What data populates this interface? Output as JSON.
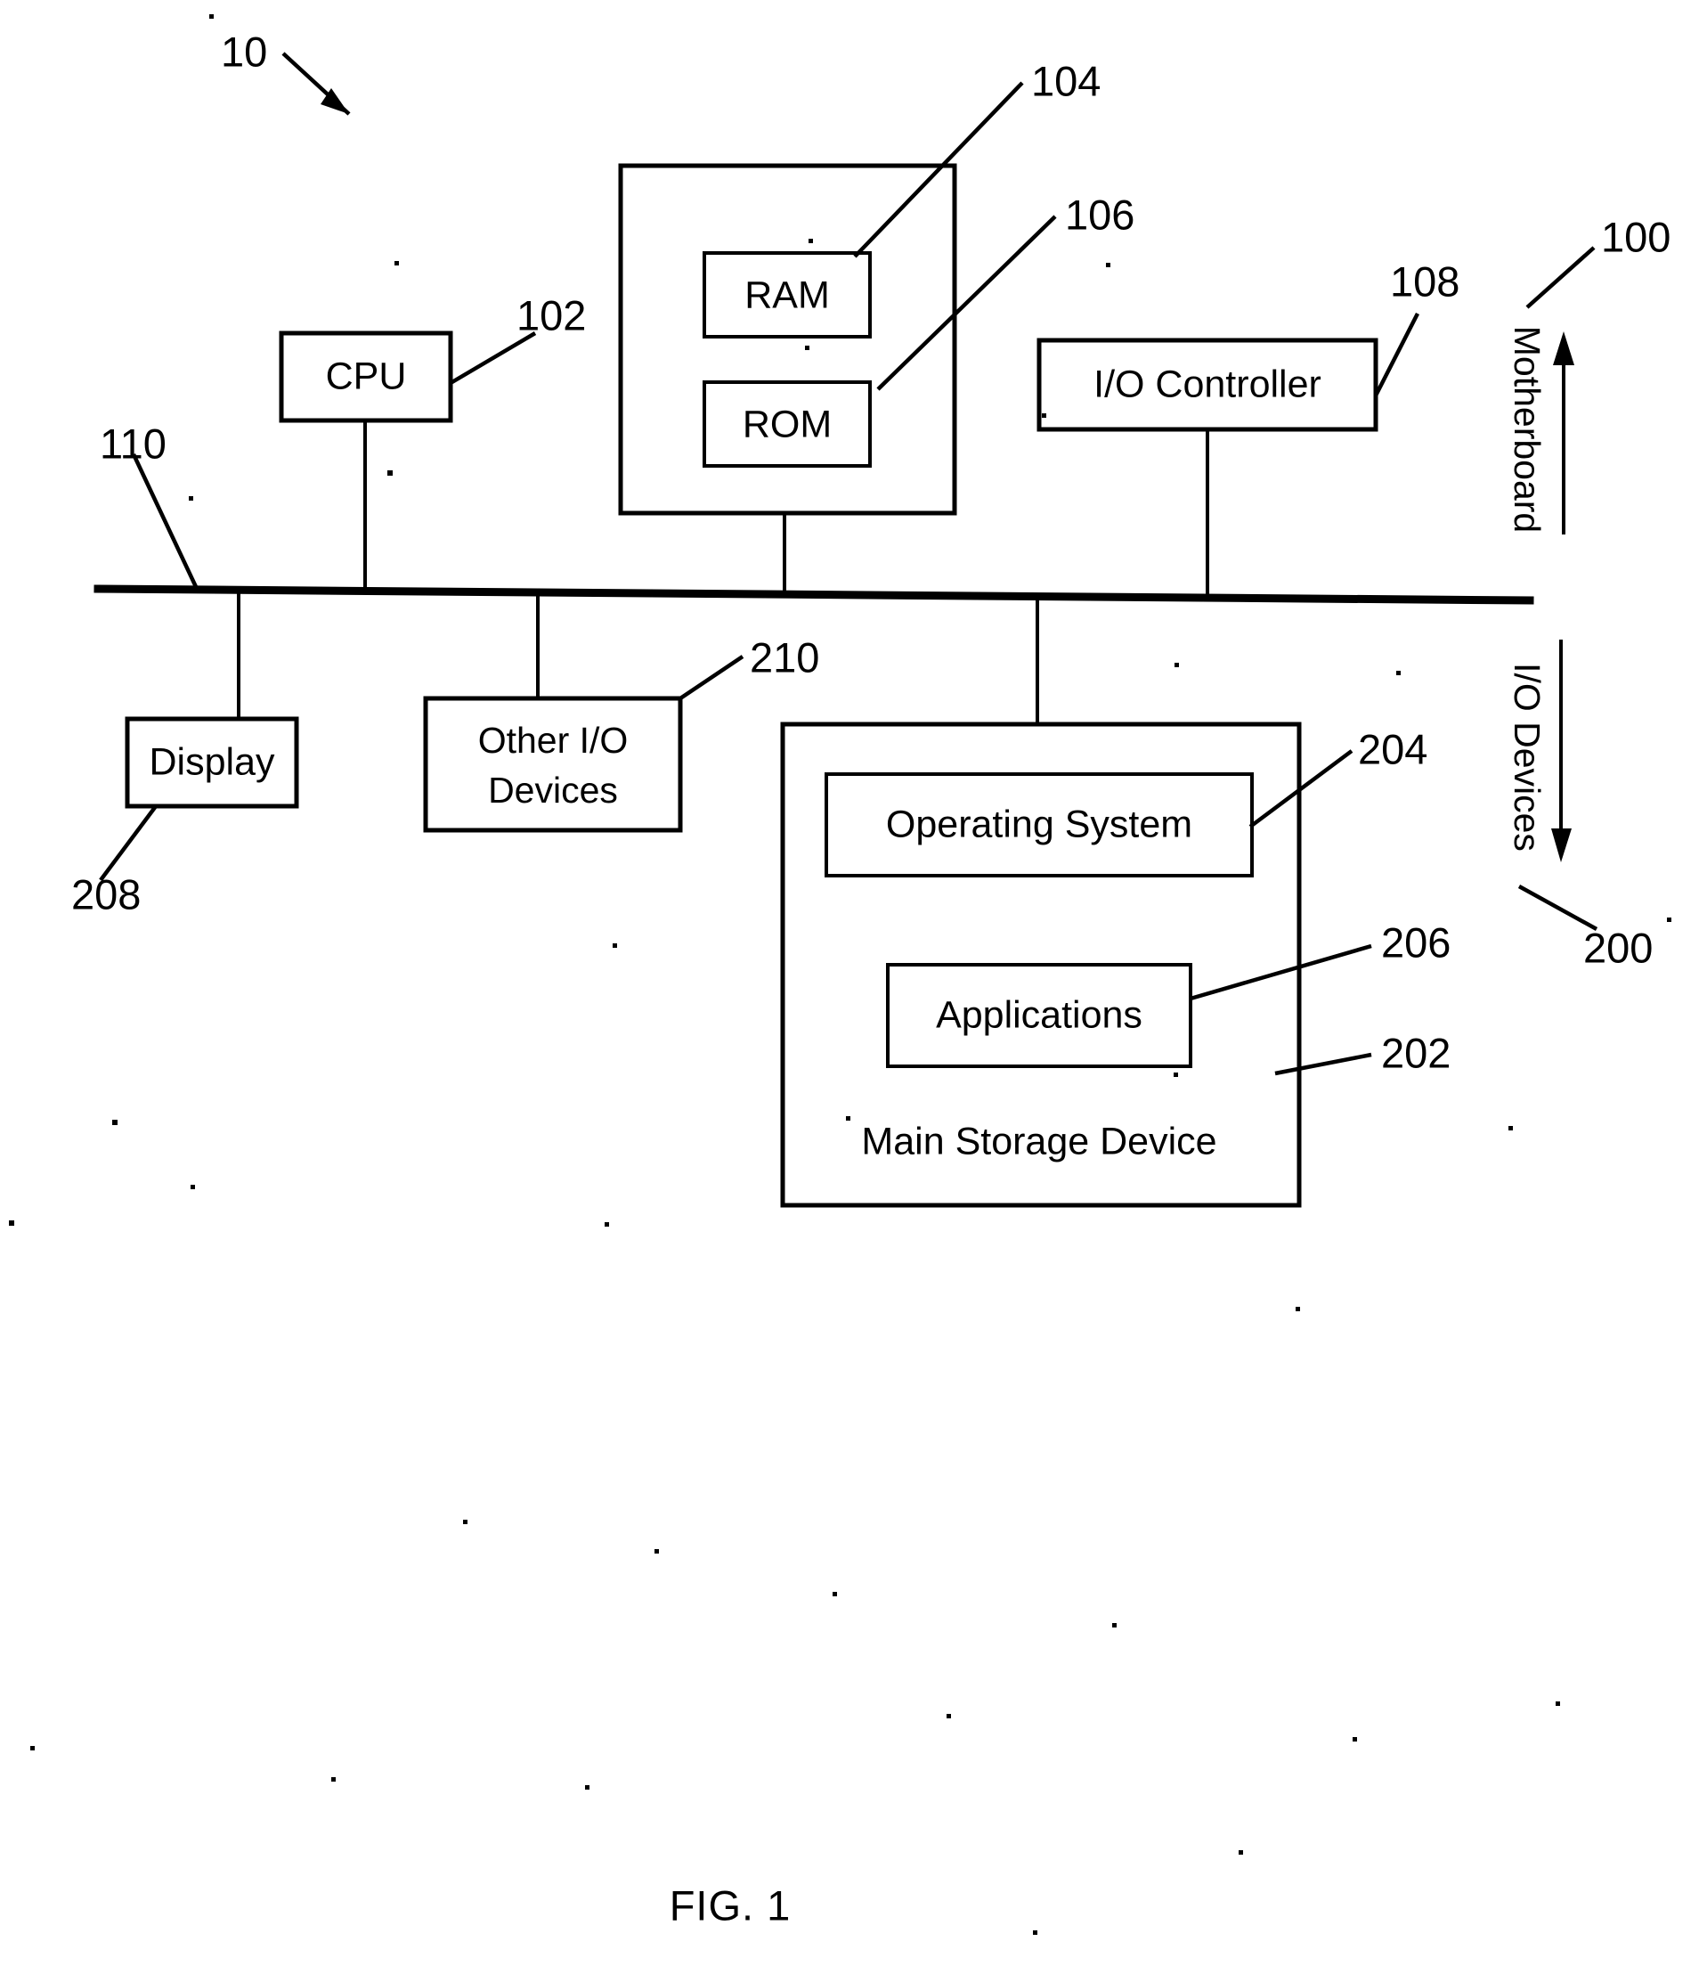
{
  "figure": {
    "caption": "FIG. 1",
    "system_ref": "10"
  },
  "blocks": {
    "cpu": {
      "label": "CPU",
      "ref": "102"
    },
    "memory_container": {
      "label": "",
      "ref": ""
    },
    "ram": {
      "label": "RAM",
      "ref": "104"
    },
    "rom": {
      "label": "ROM",
      "ref": "106"
    },
    "io_controller": {
      "label": "I/O Controller",
      "ref": "108"
    },
    "bus": {
      "label": "",
      "ref": "110"
    },
    "display": {
      "label": "Display",
      "ref": "208"
    },
    "other_io_devices": {
      "label_line1": "Other I/O",
      "label_line2": "Devices",
      "ref": "210"
    },
    "main_storage": {
      "label": "Main Storage Device",
      "ref": "202"
    },
    "operating_system": {
      "label": "Operating System",
      "ref": "204"
    },
    "applications": {
      "label": "Applications",
      "ref": "206"
    }
  },
  "groups": {
    "motherboard": {
      "label": "Motherboard",
      "ref": "100",
      "arrow_direction": "up"
    },
    "io_devices": {
      "label": "I/O Devices",
      "ref": "200",
      "arrow_direction": "down"
    }
  },
  "colors": {
    "ink": "#000000",
    "background": "#ffffff"
  }
}
